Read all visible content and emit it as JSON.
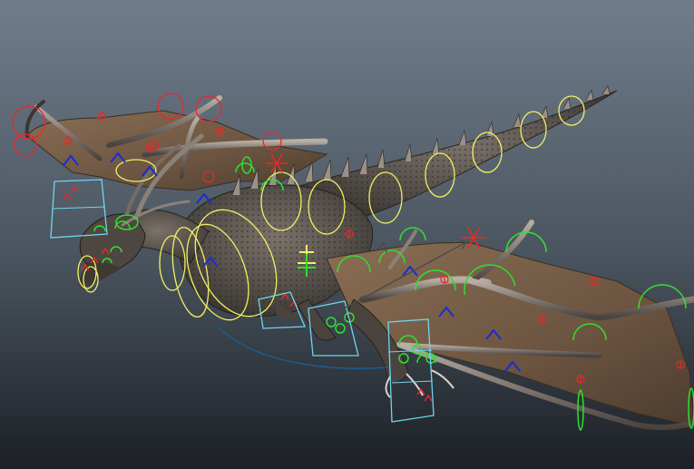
{
  "viewport": {
    "background_top": "#6f7d8b",
    "background_bottom": "#1c2026"
  },
  "colors": {
    "wing_membrane": "#6b5440",
    "wing_membrane_light": "#8a6e54",
    "wing_bone": "#6a625c",
    "wing_bone_light": "#a49a90",
    "body": "#5a534c",
    "body_dark": "#3b3632",
    "spine": "#9a9088",
    "ctrl_yellow": "#f2f062",
    "ctrl_green": "#2fe02f",
    "ctrl_red": "#e8282a",
    "ctrl_cyan": "#6fd6ee",
    "ctrl_blue": "#1b2bd8",
    "ctrl_dark_blue": "#1b5d92",
    "ctrl_gray": "#4a4a4a"
  },
  "scene": {
    "subject": "dragon-rig",
    "controls": [
      "ik-handle",
      "fk-control",
      "pole-vector",
      "foot-box",
      "axis-gizmo"
    ]
  }
}
